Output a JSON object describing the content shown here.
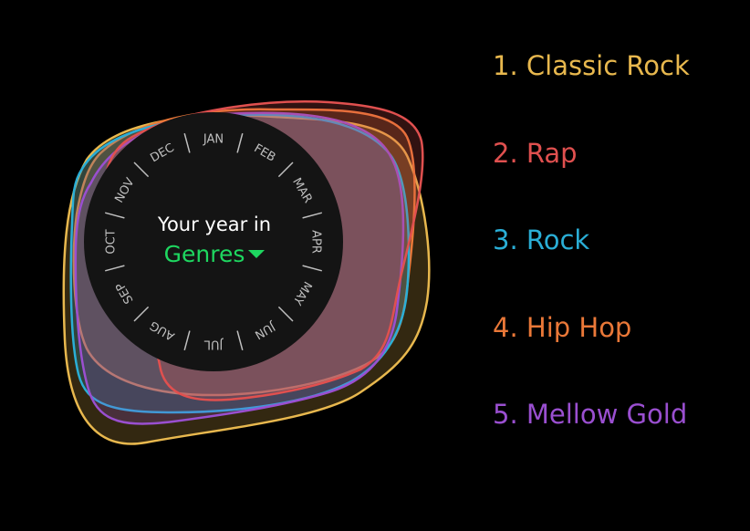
{
  "header": {
    "line1": "Your year in",
    "line2": "Genres"
  },
  "months": [
    "JAN",
    "FEB",
    "MAR",
    "APR",
    "MAY",
    "JUN",
    "JUL",
    "AUG",
    "SEP",
    "OCT",
    "NOV",
    "DEC"
  ],
  "legend": [
    {
      "rank": "1.",
      "name": "Classic Rock",
      "color": "#e8b84e"
    },
    {
      "rank": "2.",
      "name": "Rap",
      "color": "#e0504f"
    },
    {
      "rank": "3.",
      "name": "Rock",
      "color": "#2aaed6"
    },
    {
      "rank": "4.",
      "name": "Hip Hop",
      "color": "#ea7838"
    },
    {
      "rank": "5.",
      "name": "Mellow Gold",
      "color": "#9a4fd0"
    }
  ],
  "colors": {
    "accent": "#1ed760",
    "dial": "#141414",
    "month_text": "#bfbfbf"
  },
  "icons": {
    "dropdown": "caret-down-icon"
  }
}
